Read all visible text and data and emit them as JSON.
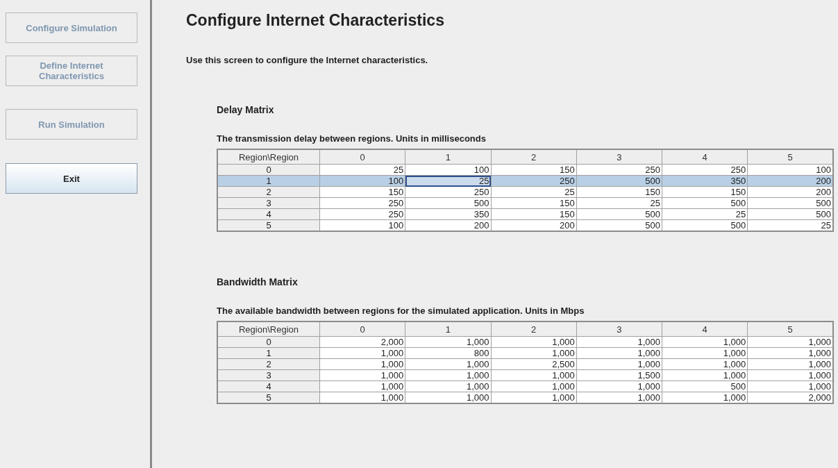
{
  "sidebar": {
    "buttons": [
      {
        "label": "Configure Simulation",
        "disabled": true
      },
      {
        "label": "Define Internet Characteristics",
        "disabled": true
      },
      {
        "label": "Run Simulation",
        "disabled": true
      },
      {
        "label": "Exit",
        "disabled": false
      }
    ]
  },
  "title": "Configure Internet Characteristics",
  "description": "Use this screen to configure the Internet characteristics.",
  "sections": [
    {
      "heading": "Delay Matrix",
      "caption": "The transmission delay between regions. Units in milliseconds",
      "table": {
        "columns": [
          "Region\\Region",
          "0",
          "1",
          "2",
          "3",
          "4",
          "5"
        ],
        "rows": [
          {
            "selected": false,
            "cells": [
              {
                "value": "0",
                "focused": false
              },
              {
                "value": "25",
                "focused": false
              },
              {
                "value": "100",
                "focused": false
              },
              {
                "value": "150",
                "focused": false
              },
              {
                "value": "250",
                "focused": false
              },
              {
                "value": "250",
                "focused": false
              },
              {
                "value": "100",
                "focused": false
              }
            ]
          },
          {
            "selected": true,
            "cells": [
              {
                "value": "1",
                "focused": false
              },
              {
                "value": "100",
                "focused": false
              },
              {
                "value": "25",
                "focused": true
              },
              {
                "value": "250",
                "focused": false
              },
              {
                "value": "500",
                "focused": false
              },
              {
                "value": "350",
                "focused": false
              },
              {
                "value": "200",
                "focused": false
              }
            ]
          },
          {
            "selected": false,
            "cells": [
              {
                "value": "2",
                "focused": false
              },
              {
                "value": "150",
                "focused": false
              },
              {
                "value": "250",
                "focused": false
              },
              {
                "value": "25",
                "focused": false
              },
              {
                "value": "150",
                "focused": false
              },
              {
                "value": "150",
                "focused": false
              },
              {
                "value": "200",
                "focused": false
              }
            ]
          },
          {
            "selected": false,
            "cells": [
              {
                "value": "3",
                "focused": false
              },
              {
                "value": "250",
                "focused": false
              },
              {
                "value": "500",
                "focused": false
              },
              {
                "value": "150",
                "focused": false
              },
              {
                "value": "25",
                "focused": false
              },
              {
                "value": "500",
                "focused": false
              },
              {
                "value": "500",
                "focused": false
              }
            ]
          },
          {
            "selected": false,
            "cells": [
              {
                "value": "4",
                "focused": false
              },
              {
                "value": "250",
                "focused": false
              },
              {
                "value": "350",
                "focused": false
              },
              {
                "value": "150",
                "focused": false
              },
              {
                "value": "500",
                "focused": false
              },
              {
                "value": "25",
                "focused": false
              },
              {
                "value": "500",
                "focused": false
              }
            ]
          },
          {
            "selected": false,
            "cells": [
              {
                "value": "5",
                "focused": false
              },
              {
                "value": "100",
                "focused": false
              },
              {
                "value": "200",
                "focused": false
              },
              {
                "value": "200",
                "focused": false
              },
              {
                "value": "500",
                "focused": false
              },
              {
                "value": "500",
                "focused": false
              },
              {
                "value": "25",
                "focused": false
              }
            ]
          }
        ]
      }
    },
    {
      "heading": "Bandwidth Matrix",
      "caption": "The available bandwidth between regions for the simulated application. Units in Mbps",
      "table": {
        "columns": [
          "Region\\Region",
          "0",
          "1",
          "2",
          "3",
          "4",
          "5"
        ],
        "rows": [
          {
            "selected": false,
            "cells": [
              {
                "value": "0",
                "focused": false
              },
              {
                "value": "2,000",
                "focused": false
              },
              {
                "value": "1,000",
                "focused": false
              },
              {
                "value": "1,000",
                "focused": false
              },
              {
                "value": "1,000",
                "focused": false
              },
              {
                "value": "1,000",
                "focused": false
              },
              {
                "value": "1,000",
                "focused": false
              }
            ]
          },
          {
            "selected": false,
            "cells": [
              {
                "value": "1",
                "focused": false
              },
              {
                "value": "1,000",
                "focused": false
              },
              {
                "value": "800",
                "focused": false
              },
              {
                "value": "1,000",
                "focused": false
              },
              {
                "value": "1,000",
                "focused": false
              },
              {
                "value": "1,000",
                "focused": false
              },
              {
                "value": "1,000",
                "focused": false
              }
            ]
          },
          {
            "selected": false,
            "cells": [
              {
                "value": "2",
                "focused": false
              },
              {
                "value": "1,000",
                "focused": false
              },
              {
                "value": "1,000",
                "focused": false
              },
              {
                "value": "2,500",
                "focused": false
              },
              {
                "value": "1,000",
                "focused": false
              },
              {
                "value": "1,000",
                "focused": false
              },
              {
                "value": "1,000",
                "focused": false
              }
            ]
          },
          {
            "selected": false,
            "cells": [
              {
                "value": "3",
                "focused": false
              },
              {
                "value": "1,000",
                "focused": false
              },
              {
                "value": "1,000",
                "focused": false
              },
              {
                "value": "1,000",
                "focused": false
              },
              {
                "value": "1,500",
                "focused": false
              },
              {
                "value": "1,000",
                "focused": false
              },
              {
                "value": "1,000",
                "focused": false
              }
            ]
          },
          {
            "selected": false,
            "cells": [
              {
                "value": "4",
                "focused": false
              },
              {
                "value": "1,000",
                "focused": false
              },
              {
                "value": "1,000",
                "focused": false
              },
              {
                "value": "1,000",
                "focused": false
              },
              {
                "value": "1,000",
                "focused": false
              },
              {
                "value": "500",
                "focused": false
              },
              {
                "value": "1,000",
                "focused": false
              }
            ]
          },
          {
            "selected": false,
            "cells": [
              {
                "value": "5",
                "focused": false
              },
              {
                "value": "1,000",
                "focused": false
              },
              {
                "value": "1,000",
                "focused": false
              },
              {
                "value": "1,000",
                "focused": false
              },
              {
                "value": "1,000",
                "focused": false
              },
              {
                "value": "1,000",
                "focused": false
              },
              {
                "value": "2,000",
                "focused": false
              }
            ]
          }
        ]
      }
    }
  ]
}
